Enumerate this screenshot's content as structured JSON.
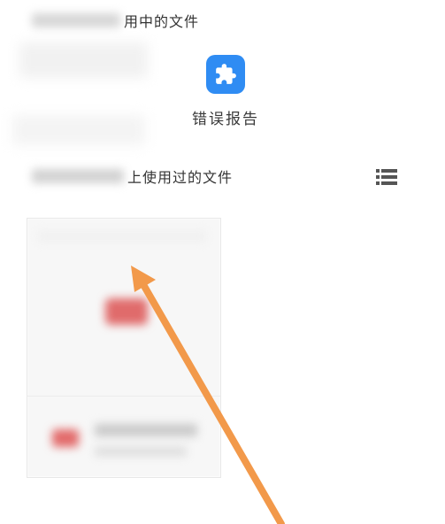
{
  "section_in_use": {
    "title_visible": "用中的文件"
  },
  "app": {
    "label": "错误报告",
    "icon": "puzzle-piece-icon",
    "color": "#2f8cf3"
  },
  "section_recent": {
    "title_visible": "上使用过的文件",
    "view_toggle_icon": "list-view-icon"
  },
  "annotation": {
    "arrow_color": "#f2994a"
  }
}
